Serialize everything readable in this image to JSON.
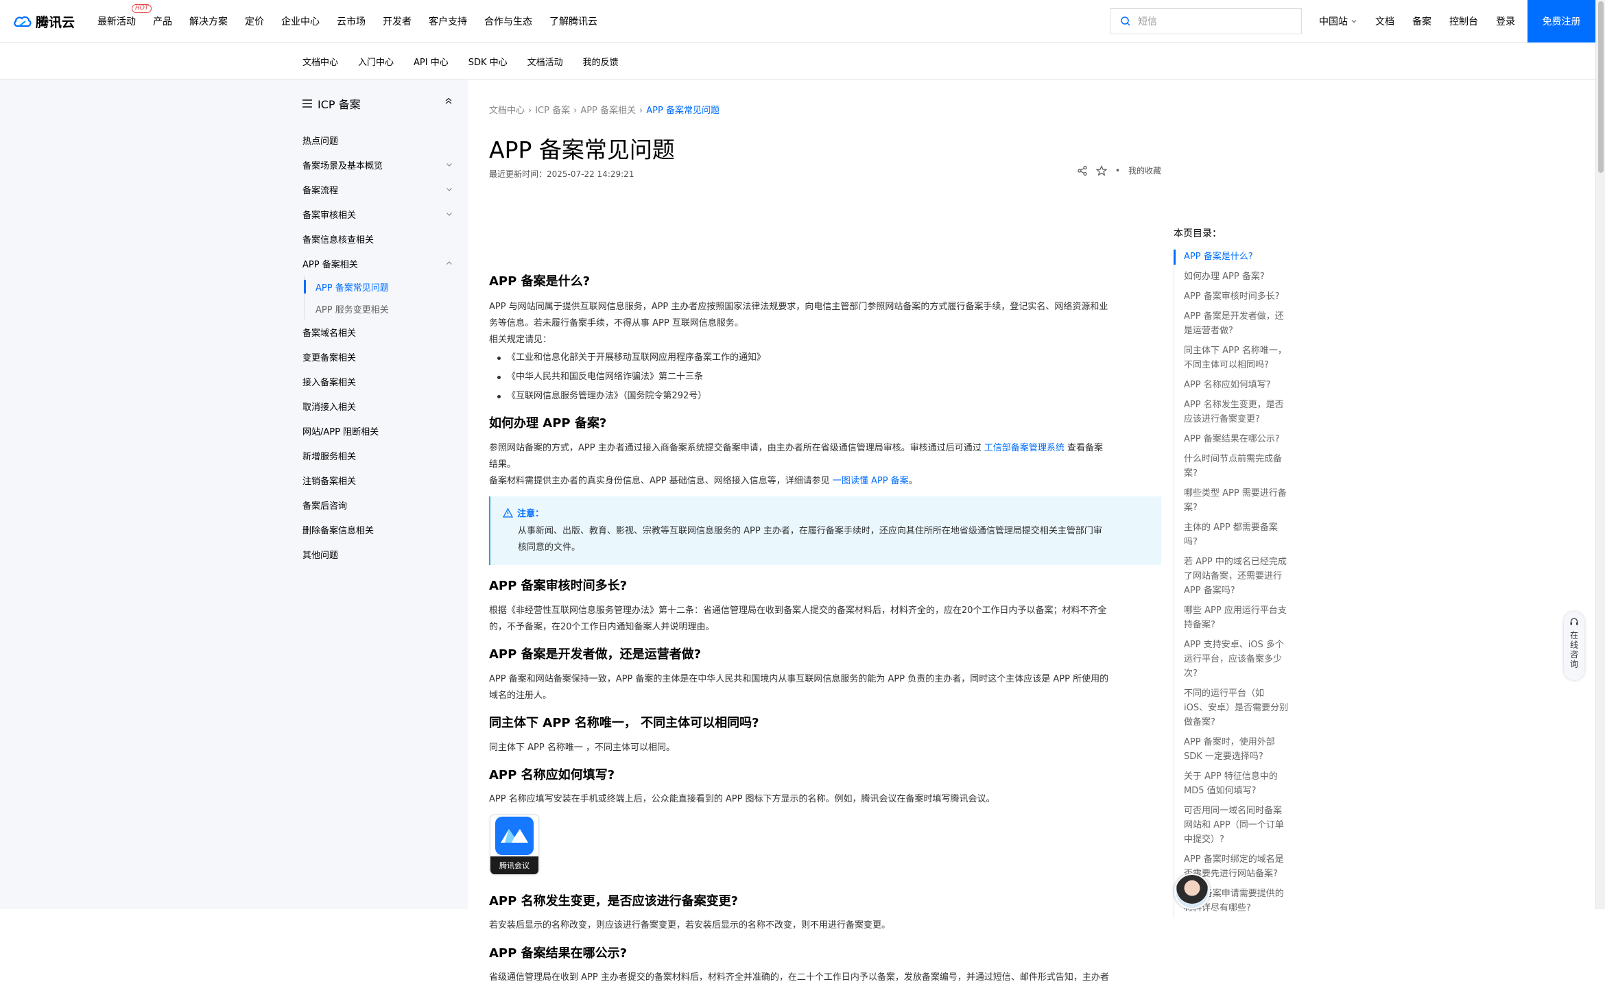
{
  "header": {
    "logo_text": "腾讯云",
    "hot_badge": "HOT",
    "nav": [
      "最新活动",
      "产品",
      "解决方案",
      "定价",
      "企业中心",
      "云市场",
      "开发者",
      "客户支持",
      "合作与生态",
      "了解腾讯云"
    ],
    "search_placeholder": "短信",
    "right_nav": [
      "中国站",
      "文档",
      "备案",
      "控制台",
      "登录"
    ],
    "register": "免费注册"
  },
  "subnav": [
    "文档中心",
    "入门中心",
    "API 中心",
    "SDK 中心",
    "文档活动",
    "我的反馈"
  ],
  "sidebar": {
    "title": "ICP 备案",
    "items": [
      {
        "label": "热点问题",
        "chevron": false
      },
      {
        "label": "备案场景及基本概览",
        "chevron": true
      },
      {
        "label": "备案流程",
        "chevron": true
      },
      {
        "label": "备案审核相关",
        "chevron": true
      },
      {
        "label": "备案信息核查相关",
        "chevron": false
      },
      {
        "label": "APP 备案相关",
        "chevron": "up"
      }
    ],
    "sub_items": [
      "APP 备案常见问题",
      "APP 服务变更相关"
    ],
    "items_after": [
      "备案域名相关",
      "变更备案相关",
      "接入备案相关",
      "取消接入相关",
      "网站/APP 阻断相关",
      "新增服务相关",
      "注销备案相关",
      "备案后咨询",
      "删除备案信息相关",
      "其他问题"
    ]
  },
  "main": {
    "breadcrumb": [
      "文档中心",
      "ICP 备案",
      "APP 备案相关",
      "APP 备案常见问题"
    ],
    "title": "APP 备案常见问题",
    "updated": "最近更新时间：2025-07-22 14:29:21",
    "favorite": "我的收藏",
    "s1_title": "APP 备案是什么?",
    "s1_p1": "APP 与网站同属于提供互联网信息服务，APP 主办者应按照国家法律法规要求，向电信主管部门参照网站备案的方式履行备案手续，登记实名、网络资源和业",
    "s1_p2": "务等信息。若未履行备案手续，不得从事 APP 互联网信息服务。",
    "s1_p3": "相关规定请见：",
    "s1_list": [
      "《工业和信息化部关于开展移动互联网应用程序备案工作的通知》",
      "《中华人民共和国反电信网络诈骗法》第二十三条",
      "《互联网信息服务管理办法》（国务院令第292号）"
    ],
    "s2_title": "如何办理 APP 备案?",
    "s2_p1a": "参照网站备案的方式，APP 主办者通过接入商备案系统提交备案申请，由主办者所在省级通信管理局审核。审核通过后可通过 ",
    "s2_p1_link": "工信部备案管理系统",
    "s2_p1b": " 查看备案",
    "s2_p2": "结果。",
    "s2_p3a": "备案材料需提供主办者的真实身份信息、APP 基础信息、网络接入信息等，详细请参见 ",
    "s2_p3_link": "一图读懂 APP 备案",
    "s2_p3b": "。",
    "note_title": "注意：",
    "note_l1": "从事新闻、出版、教育、影视、宗教等互联网信息服务的 APP 主办者，在履行备案手续时，还应向其住所所在地省级通信管理局提交相关主管部门审",
    "note_l2": "核同意的文件。",
    "s3_title": "APP 备案审核时间多长?",
    "s3_p1": "根据《非经营性互联网信息服务管理办法》第十二条：省通信管理局在收到备案人提交的备案材料后，材料齐全的，应在20个工作日内予以备案；材料不齐全",
    "s3_p2": "的，不予备案，在20个工作日内通知备案人并说明理由。",
    "s4_title": "APP 备案是开发者做，还是运营者做?",
    "s4_p1": "APP 备案和网站备案保持一致，APP 备案的主体是在中华人民共和国境内从事互联网信息服务的能为 APP 负责的主办者，同时这个主体应该是 APP 所使用的",
    "s4_p2": "域名的注册人。",
    "s5_title": "同主体下 APP 名称唯一， 不同主体可以相同吗?",
    "s5_p1": "同主体下 APP 名称唯一 ，不同主体可以相同。",
    "s6_title": "APP 名称应如何填写?",
    "s6_p1": "APP 名称应填写安装在手机或终端上后，公众能直接看到的 APP 图标下方显示的名称。例如，腾讯会议在备案时填写腾讯会议。",
    "app_icon_label": "腾讯会议",
    "s7_title": "APP 名称发生变更，是否应该进行备案变更?",
    "s7_p1": "若安装后显示的名称改变，则应该进行备案变更，若安装后显示的名称不改变，则不用进行备案变更。",
    "s8_title": "APP 备案结果在哪公示?",
    "s8_p1": "省级通信管理局在收到 APP 主办者提交的备案材料后，材料齐全并准确的，在二十个工作日内予以备案，发放备案编号，并通过短信、邮件形式告知，主办者"
  },
  "toc": {
    "title": "本页目录：",
    "items": [
      [
        "APP 备案是什么?"
      ],
      [
        "如何办理 APP 备案?"
      ],
      [
        "APP 备案审核时间多长?"
      ],
      [
        "APP 备案是开发者做，还",
        "是运营者做?"
      ],
      [
        "同主体下 APP 名称唯一，",
        "不同主体可以相同吗?"
      ],
      [
        "APP 名称应如何填写?"
      ],
      [
        "APP 名称发生变更，是否",
        "应该进行备案变更?"
      ],
      [
        "APP 备案结果在哪公示?"
      ],
      [
        "什么时间节点前需完成备",
        "案?"
      ],
      [
        "哪些类型 APP 需要进行备",
        "案?"
      ],
      [
        "主体的 APP 都需要备案",
        "吗?"
      ],
      [
        "若 APP 中的域名已经完成",
        "了网站备案，还需要进行",
        "APP 备案吗?"
      ],
      [
        "哪些 APP 应用运行平台支",
        "持备案?"
      ],
      [
        "APP 支持安卓、iOS 多个",
        "运行平台，应该备案多少",
        "次?"
      ],
      [
        "不同的运行平台（如",
        "iOS、安卓）是否需要分别",
        "做备案?"
      ],
      [
        "APP 备案时，使用外部",
        "SDK 一定要选择吗?"
      ],
      [
        "关于 APP 特征信息中的",
        "MD5 值如何填写?"
      ],
      [
        "可否用同一域名同时备案",
        "网站和 APP（同一个订单",
        "中提交）?"
      ],
      [
        "APP 备案时绑定的域名是",
        "否需要先进行网站备案?"
      ],
      [
        "APP 备案申请需要提供的",
        "材料详尽有哪些?"
      ]
    ]
  },
  "float": {
    "consult": "在线咨询"
  },
  "colors": {
    "accent": "#006eff",
    "note_bg": "#eaf7fd",
    "sidebar_bg": "#f6f7fb"
  }
}
